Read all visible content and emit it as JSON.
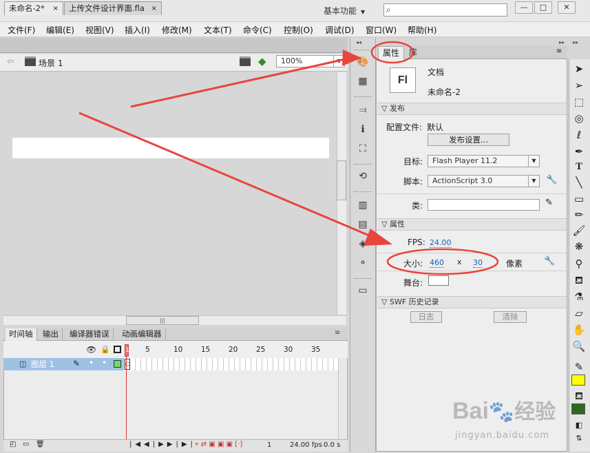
{
  "app": {
    "logo": "Fl",
    "workspace": "基本功能",
    "search_icon": "magnifier-icon",
    "window_buttons": [
      "—",
      "□",
      "✕"
    ]
  },
  "menu": [
    "文件(F)",
    "编辑(E)",
    "视图(V)",
    "插入(I)",
    "修改(M)",
    "文本(T)",
    "命令(C)",
    "控制(O)",
    "调试(D)",
    "窗口(W)",
    "帮助(H)"
  ],
  "doc_tabs": [
    {
      "label": "未命名-2*",
      "close": "×",
      "active": true
    },
    {
      "label": "上传文件设计界面.fla",
      "close": "×",
      "active": false
    }
  ],
  "edit_bar": {
    "scene": "场景 1",
    "zoom": "100%"
  },
  "timeline": {
    "tabs": [
      "时间轴",
      "输出",
      "编译器错误",
      "动画编辑器"
    ],
    "frame_numbers": [
      "1",
      "5",
      "10",
      "15",
      "20",
      "25",
      "30",
      "35"
    ],
    "layer_name": "图层 1",
    "current_frame": "1",
    "fps": "24.00",
    "fps_unit": "fps",
    "elapsed": "0.0 s"
  },
  "properties": {
    "tabs": [
      "属性",
      "库"
    ],
    "doc_icon_text": "Fl",
    "doc_type": "文档",
    "doc_name": "未命名-2",
    "publish_section": "发布",
    "profile_label": "配置文件:",
    "profile_value": "默认",
    "publish_settings_button": "发布设置...",
    "target_label": "目标:",
    "target_value": "Flash Player 11.2",
    "script_label": "脚本:",
    "script_value": "ActionScript 3.0",
    "class_label": "类:",
    "class_value": "",
    "props_section": "属性",
    "fps_label": "FPS:",
    "fps_value": "24.00",
    "size_label": "大小:",
    "width": "460",
    "size_x": "x",
    "height": "30",
    "size_unit": "像素",
    "stage_label": "舞台:",
    "stage_color": "#ffffff",
    "history_section": "SWF 历史记录",
    "log_button": "日志",
    "clear_button": "清除"
  },
  "colors": {
    "stroke_swatch": "#ffff00",
    "fill_swatch": "#2d6a1f",
    "annotation": "#e8453c",
    "playhead": "#f06e6e",
    "layer_highlight": "#9fc1e4"
  },
  "watermark": {
    "brand_latin": "Bai",
    "brand_cn": "经验",
    "url": "jingyan.baidu.com"
  }
}
